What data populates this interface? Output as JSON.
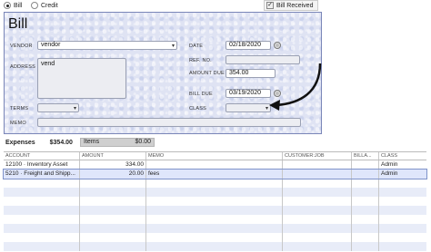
{
  "top": {
    "bill_radio": "Bill",
    "credit_radio": "Credit",
    "bill_received": "Bill Received"
  },
  "form": {
    "title": "Bill",
    "vendor_label": "VENDOR",
    "vendor_value": "vendor",
    "address_label": "ADDRESS",
    "address_value": "vend",
    "terms_label": "TERMS",
    "memo_label": "MEMO",
    "date_label": "DATE",
    "date_value": "02/18/2020",
    "ref_label": "REF. NO.",
    "amount_label": "AMOUNT DUE",
    "amount_value": "354.00",
    "billdue_label": "BILL DUE",
    "billdue_value": "03/19/2020",
    "class_label": "CLASS"
  },
  "tabs": {
    "expenses_label": "Expenses",
    "expenses_amount": "$354.00",
    "items_label": "Items",
    "items_amount": "$0.00"
  },
  "grid": {
    "headers": [
      "ACCOUNT",
      "AMOUNT",
      "MEMO",
      "CUSTOMER:JOB",
      "BILLA...",
      "CLASS"
    ],
    "rows": [
      {
        "account": "12100 · Inventory Asset",
        "amount": "334.00",
        "memo": "",
        "customer": "",
        "billable": "",
        "class": "Admin"
      },
      {
        "account": "5210 · Freight and Shipp...",
        "amount": "20.00",
        "memo": "fees",
        "customer": "",
        "billable": "",
        "class": "Admin"
      }
    ]
  },
  "colors": {
    "panel_bg": "#dfe3f3",
    "arrow": "#111111",
    "selected_row": "#dfe6fb"
  },
  "icons": [
    "radio-icon",
    "checkbox-icon",
    "dropdown-caret-icon",
    "calendar-icon",
    "arrow-annotation-icon"
  ]
}
